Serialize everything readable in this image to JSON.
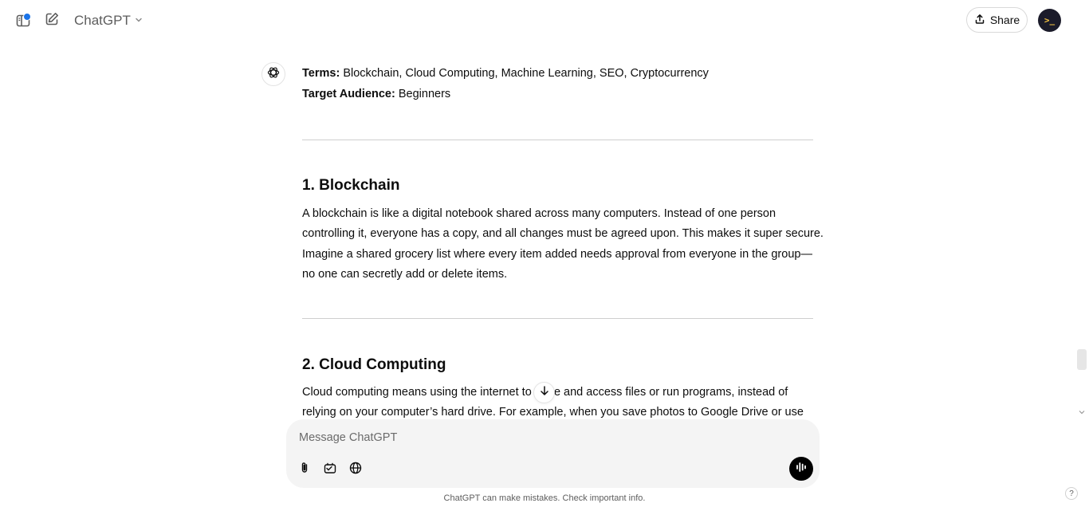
{
  "header": {
    "model_name": "ChatGPT",
    "share_label": "Share",
    "avatar_text": ">_"
  },
  "message": {
    "terms_label": "Terms:",
    "terms_value": "Blockchain, Cloud Computing, Machine Learning, SEO, Cryptocurrency",
    "audience_label": "Target Audience:",
    "audience_value": "Beginners",
    "sections": [
      {
        "heading": "1. Blockchain",
        "lines": [
          "A blockchain is like a digital notebook shared across many computers. Instead of one person",
          "controlling it, everyone has a copy, and all changes must be agreed upon. This makes it super secure.",
          "Imagine a shared grocery list where every item added needs approval from everyone in the group—",
          "no one can secretly add or delete items."
        ]
      },
      {
        "heading": "2. Cloud Computing",
        "lines": [
          "Cloud computing means using the internet to store and access files or run programs, instead of",
          "relying on your computer’s hard drive. For example, when you save photos to Google Drive or use"
        ]
      }
    ]
  },
  "composer": {
    "placeholder": "Message ChatGPT"
  },
  "footer": {
    "disclaimer": "ChatGPT can make mistakes. Check important info.",
    "help_label": "?"
  },
  "icons": {
    "sidebar": "sidebar-toggle-icon",
    "new_chat": "new-chat-icon",
    "chevron": "chevron-down-icon",
    "share": "share-icon",
    "assistant": "openai-logo-icon",
    "scroll_down": "arrow-down-icon",
    "attach": "paperclip-icon",
    "tools": "tools-icon",
    "search": "globe-icon",
    "voice": "voice-waveform-icon"
  },
  "colors": {
    "notification_dot": "#1a73e8",
    "composer_bg": "#f4f4f4",
    "avatar_bg": "#1b1b2a"
  }
}
